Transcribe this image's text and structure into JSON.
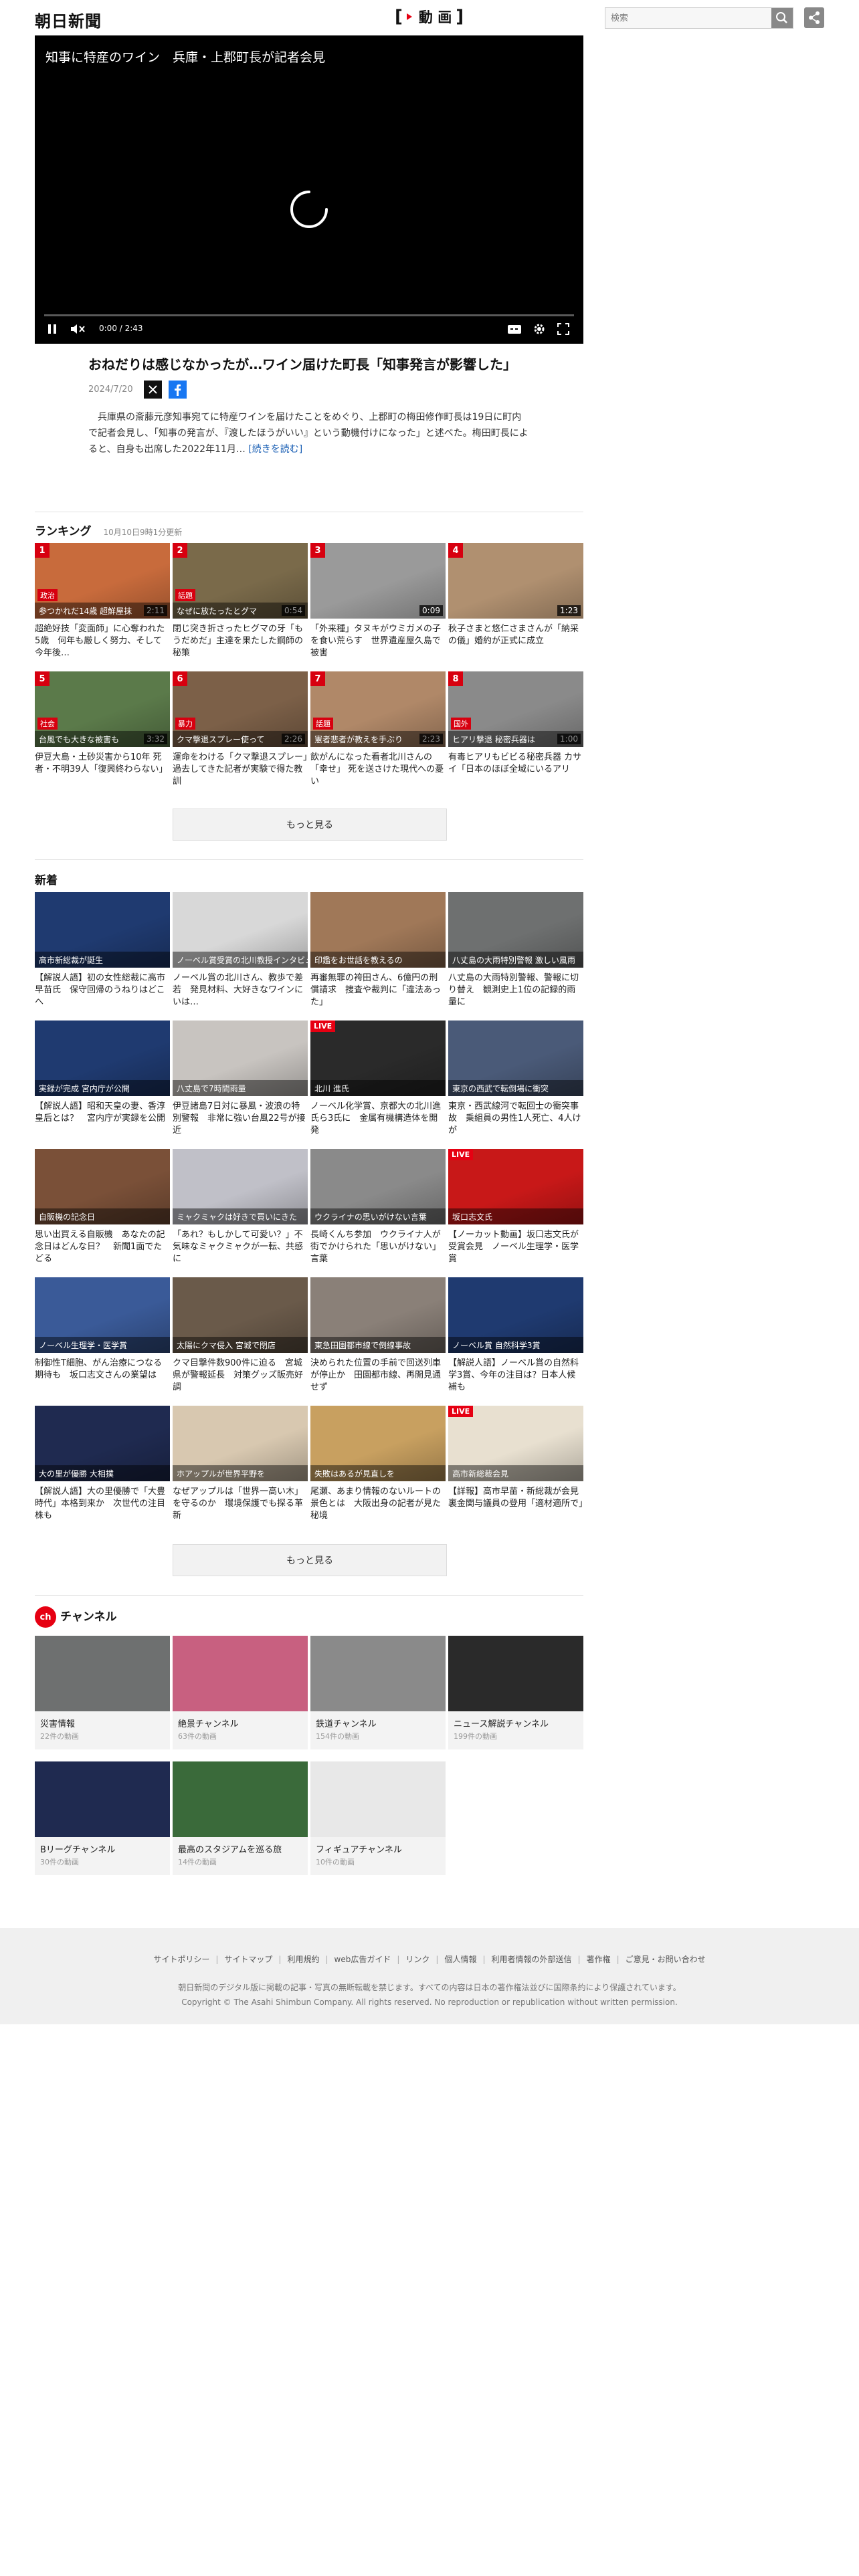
{
  "header": {
    "logo": "朝日新聞",
    "video_brand": "動 画",
    "search_placeholder": "検索"
  },
  "player": {
    "title": "知事に特産のワイン　兵庫・上郡町長が記者会見",
    "time": "0:00 / 2:43",
    "progress_fraction": 0.0
  },
  "article": {
    "headline": "おねだりは感じなかったが…ワイン届けた町長「知事発言が影響した」",
    "date": "2024/7/20",
    "summary": "兵庫県の斎藤元彦知事宛てに特産ワインを届けたことをめぐり、上郡町の梅田修作町長は19日に町内で記者会見し、「知事の発言が、『渡したほうがいい』という動機付けになった」と述べた。梅田町長によると、自身も出席した2022年11月…",
    "read_more": "[続きを読む]"
  },
  "ranking": {
    "heading": "ランキング",
    "updated": "10月10日9時1分更新",
    "more": "もっと見る",
    "items": [
      {
        "rank": "1",
        "tag": "政治",
        "caption": "参つかれだ14歳 超鮮屋抹",
        "duration": "2:11",
        "title": "超絶好技「変面師」に心奪われた5歳　何年も厳しく努力、そして今年後…",
        "color": "#c86b3c"
      },
      {
        "rank": "2",
        "tag": "話題",
        "caption": "なぜに放たったとグマ",
        "duration": "0:54",
        "title": "閉じ突き折さったヒグマの牙「もうだめだ」主達を果たした鋼師の秘策",
        "color": "#7a6a4a"
      },
      {
        "rank": "3",
        "tag": "",
        "caption": "",
        "duration": "0:09",
        "title": "「外来種」タヌキがウミガメの子を食い荒らす　世界遺産屋久島で被害",
        "color": "#9a9a9a"
      },
      {
        "rank": "4",
        "tag": "",
        "caption": "",
        "duration": "1:23",
        "title": "秋子さまと悠仁さまさんが「納采の儀」婚約が正式に成立",
        "color": "#b09070"
      },
      {
        "rank": "5",
        "tag": "社会",
        "caption": "台風でも大きな被害も",
        "duration": "3:32",
        "title": "伊豆大島・土砂災害から10年 死者・不明39人「復興終わらない」",
        "color": "#5b7a4a"
      },
      {
        "rank": "6",
        "tag": "暴力",
        "caption": "クマ撃退スプレー使って",
        "duration": "2:26",
        "title": "運命をわける「クマ撃退スプレー」過去してきた記者が実験で得た教訓",
        "color": "#7c6048"
      },
      {
        "rank": "7",
        "tag": "話題",
        "caption": "憲者悲者が教えを手ぶり",
        "duration": "2:23",
        "title": "飲がんになった看者北川さんの「幸せ」 死を送さけた現代への憂い",
        "color": "#b08868"
      },
      {
        "rank": "8",
        "tag": "国外",
        "caption": "ヒアリ撃退 秘密兵器は",
        "duration": "1:00",
        "title": "有毒ヒアリもビビる秘密兵器 カサイ「日本のほぼ全域にいるアリ",
        "color": "#8a8a8a"
      }
    ]
  },
  "latest": {
    "heading": "新着",
    "more": "もっと見る",
    "items": [
      {
        "tag": "",
        "live": "",
        "caption": "高市新総裁が誕生",
        "title": "【解説人語】初の女性総裁に高市早苗氏　保守回帰のうねりはどこへ",
        "color": "#1f3a70"
      },
      {
        "tag": "",
        "live": "",
        "caption": "ノーベル賞受賞の北川教授インタビュー",
        "title": "ノーベル賞の北川さん、教歩で差若　発見材料、大好きなワインにいは…",
        "color": "#d8d8d8"
      },
      {
        "tag": "",
        "live": "",
        "caption": "印鑑をお世話を教えるの",
        "title": "再審無罪の袴田さん、6億円の刑償請求　捜査や裁判に「違法あった」",
        "color": "#a07858"
      },
      {
        "tag": "",
        "live": "",
        "caption": "八丈島の大雨特別警報 激しい風雨",
        "title": "八丈島の大雨特別警報、警報に切り替え　観測史上1位の記録的雨量に",
        "color": "#6e7070"
      },
      {
        "tag": "",
        "live": "",
        "caption": "実録が完成 宮内庁が公開",
        "title": "【解説人語】昭和天皇の妻、香淳皇后とは？　宮内庁が実録を公開",
        "color": "#1f3a70"
      },
      {
        "tag": "",
        "live": "",
        "caption": "八丈島で7時間雨量",
        "title": "伊豆諸島7日対に暴風・波浪の特別警報　非常に強い台風22号が接近",
        "color": "#c8c4c0"
      },
      {
        "tag": "",
        "live": "LIVE",
        "caption": "北川 進氏",
        "title": "ノーベル化学賞、京都大の北川進氏ら3氏に　金属有機構造体を開発",
        "color": "#2a2a2a"
      },
      {
        "tag": "",
        "live": "",
        "caption": "東京の西武で転倒場に衝突",
        "title": "東京・西武線河で転回士の衝突事故　乗組員の男性1人死亡、4人けが",
        "color": "#4a5a78"
      },
      {
        "tag": "",
        "live": "",
        "caption": "自販機の記念日",
        "title": "思い出買える自販機　あなたの記念日はどんな日？　新聞1面でたどる",
        "color": "#7a5038"
      },
      {
        "tag": "",
        "live": "",
        "caption": "ミャクミャクは好きで買いにきた",
        "title": "「あれ？もしかして可愛い？」不気味なミャクミャクが一転、共感に",
        "color": "#c0c0c8"
      },
      {
        "tag": "",
        "live": "",
        "caption": "ウクライナの思いがけない言葉",
        "title": "長崎くんち参加　ウクライナ人が街でかけられた「思いがけない」言葉",
        "color": "#8a8a8a"
      },
      {
        "tag": "",
        "live": "LIVE",
        "caption": "坂口志文氏",
        "title": "【ノーカット動画】坂口志文氏が受賞会見　ノーベル生理学・医学賞",
        "color": "#c81818"
      },
      {
        "tag": "",
        "live": "",
        "caption": "ノーベル生理学・医学賞",
        "title": "制御性T細胞、がん治療につなる期待も　坂口志文さんの業望は",
        "color": "#3a5a98"
      },
      {
        "tag": "",
        "live": "",
        "caption": "太陽にクマ侵入 宮城で閉店",
        "title": "クマ目撃件数900件に迫る　宮城県が警報延長　対策グッズ販売好調",
        "color": "#6a5a4a"
      },
      {
        "tag": "",
        "live": "",
        "caption": "東急田園都市線で倒線事故",
        "title": "決められた位置の手前で回送列車が停止か　田園都市線、再開見通せず",
        "color": "#8a8078"
      },
      {
        "tag": "",
        "live": "",
        "caption": "ノーベル賞 自然科学3賞",
        "title": "【解説人語】ノーベル賞の自然科学3賞、今年の注目は？日本人候補も",
        "color": "#1f3a70"
      },
      {
        "tag": "",
        "live": "",
        "caption": "大の里が優勝 大相撲",
        "title": "【解説人語】大の里優勝で「大豊時代」本格到来か　次世代の注目株も",
        "color": "#1f2a50"
      },
      {
        "tag": "",
        "live": "",
        "caption": "ホアップルが世界平野を",
        "title": "なぜアップルは「世界一高い木」を守るのか　環境保護でも探る革新",
        "color": "#d8c8b0"
      },
      {
        "tag": "",
        "live": "",
        "caption": "失敗はあるが見直しを",
        "title": "尾瀬、あまり情報のないルートの景色とは　大阪出身の記者が見た秘境",
        "color": "#c8a060"
      },
      {
        "tag": "",
        "live": "LIVE",
        "caption": "高市新総裁会見",
        "title": "【詳報】高市早苗・新総裁が会見　裏金関与議員の登用「適材適所で」",
        "color": "#e8e0d0"
      }
    ]
  },
  "channels": {
    "heading": "チャンネル",
    "icon_text": "ch",
    "items": [
      {
        "name": "災害情報",
        "count": "22件の動画",
        "color": "#6e7070"
      },
      {
        "name": "絶景チャンネル",
        "count": "63件の動画",
        "color": "#c86080"
      },
      {
        "name": "鉄道チャンネル",
        "count": "154件の動画",
        "color": "#8a8a8a"
      },
      {
        "name": "ニュース解説チャンネル",
        "count": "199件の動画",
        "color": "#2a2a2a"
      },
      {
        "name": "Bリーグチャンネル",
        "count": "30件の動画",
        "color": "#1f2a50"
      },
      {
        "name": "最高のスタジアムを巡る旅",
        "count": "14件の動画",
        "color": "#3a6a3a"
      },
      {
        "name": "フィギュアチャンネル",
        "count": "10件の動画",
        "color": "#e8e8e8"
      }
    ]
  },
  "footer": {
    "links": [
      "サイトポリシー",
      "サイトマップ",
      "利用規約",
      "web広告ガイド",
      "リンク",
      "個人情報",
      "利用者情報の外部送信",
      "著作権",
      "ご意見・お問い合わせ"
    ],
    "note": "朝日新聞のデジタル版に掲載の記事・写真の無断転載を禁じます。すべての内容は日本の著作権法並びに国際条約により保護されています。",
    "copyright": "Copyright © The Asahi Shimbun Company. All rights reserved. No reproduction or republication without written permission."
  }
}
